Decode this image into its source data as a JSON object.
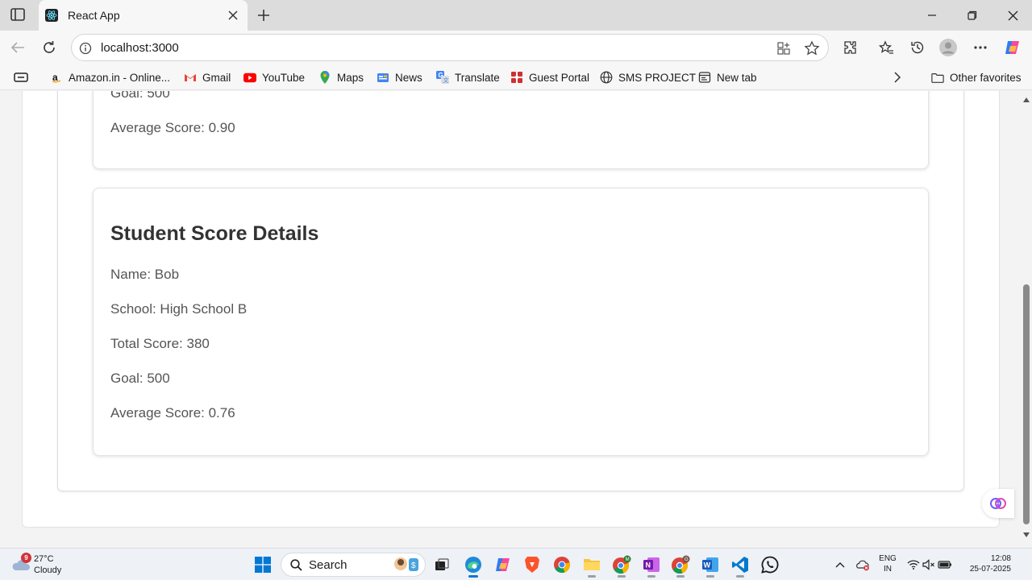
{
  "browser": {
    "tab_title": "React App",
    "url": "localhost:3000"
  },
  "favorites": [
    {
      "label": "Amazon.in - Online...",
      "icon": "amazon-icon"
    },
    {
      "label": "Gmail",
      "icon": "gmail-icon"
    },
    {
      "label": "YouTube",
      "icon": "youtube-icon"
    },
    {
      "label": "Maps",
      "icon": "maps-icon"
    },
    {
      "label": "News",
      "icon": "news-icon"
    },
    {
      "label": "Translate",
      "icon": "translate-icon"
    },
    {
      "label": "Guest Portal",
      "icon": "guest-portal-icon"
    },
    {
      "label": "SMS PROJECT",
      "icon": "globe-icon"
    },
    {
      "label": "New tab",
      "icon": "new-tab-icon"
    }
  ],
  "other_favorites": "Other favorites",
  "previous_card": {
    "goal": "Goal: 500",
    "average": "Average Score: 0.90"
  },
  "student": {
    "heading": "Student Score Details",
    "name": "Name: Bob",
    "school": "School: High School B",
    "total": "Total Score: 380",
    "goal": "Goal: 500",
    "average": "Average Score: 0.76"
  },
  "taskbar": {
    "weather_badge": "9",
    "temperature": "27°C",
    "condition": "Cloudy",
    "search_label": "Search",
    "lang_top": "ENG",
    "lang_bottom": "IN",
    "time": "12:08",
    "date": "25-07-2025"
  },
  "colors": {
    "heading": "#333333",
    "body_text": "#555555",
    "accent": "#0078d4"
  }
}
